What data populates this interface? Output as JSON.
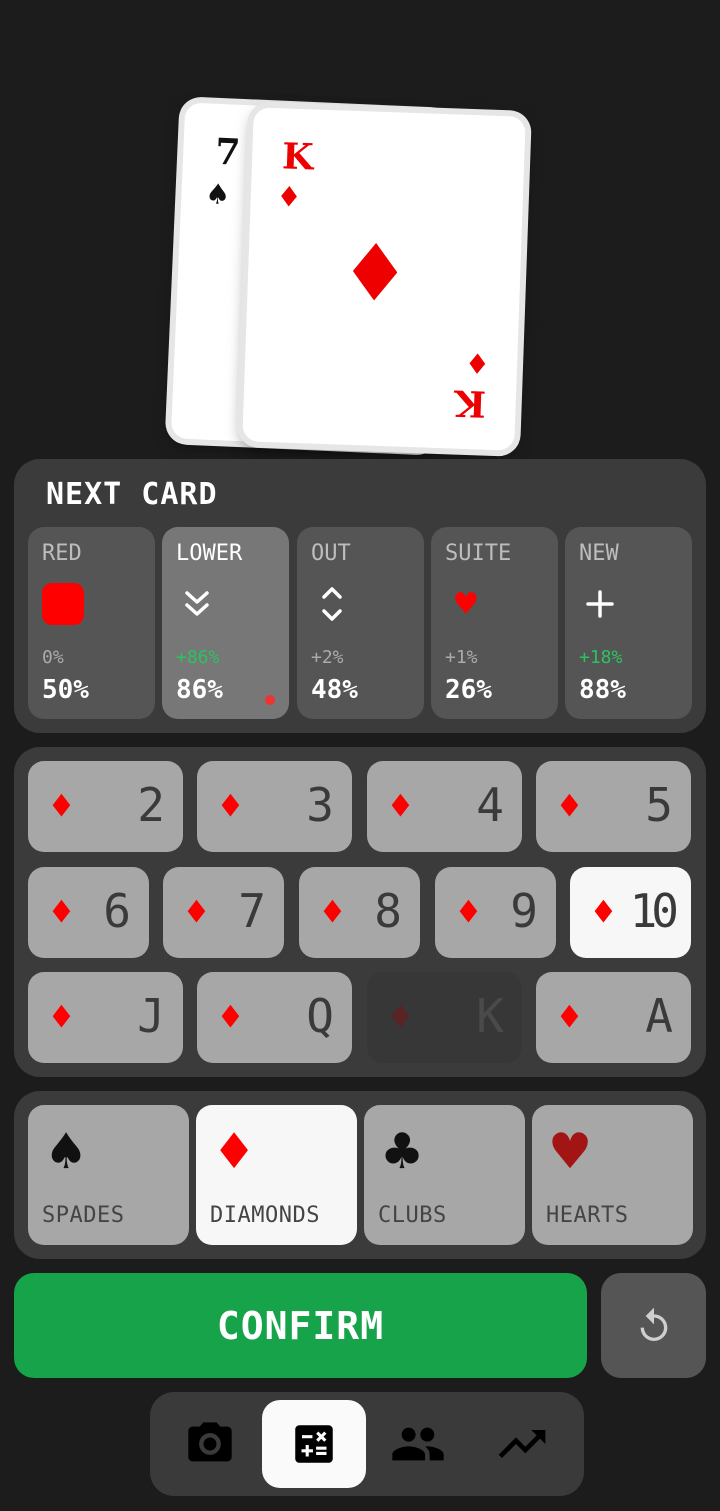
{
  "cards": {
    "back": {
      "rank": "7",
      "suit": "♠"
    },
    "front": {
      "rank": "K",
      "suit": "♦"
    }
  },
  "next_card": {
    "title": "NEXT CARD",
    "options": [
      {
        "label": "RED",
        "delta": "0%",
        "value": "50%"
      },
      {
        "label": "LOWER",
        "delta": "+86%",
        "value": "86%"
      },
      {
        "label": "OUT",
        "delta": "+2%",
        "value": "48%"
      },
      {
        "label": "SUITE",
        "delta": "+1%",
        "value": "26%"
      },
      {
        "label": "NEW",
        "delta": "+18%",
        "value": "88%"
      }
    ]
  },
  "ranks": {
    "suit_symbol": "♦",
    "row1": [
      "2",
      "3",
      "4",
      "5"
    ],
    "row2": [
      "6",
      "7",
      "8",
      "9",
      "10"
    ],
    "row3": [
      "J",
      "Q",
      "K",
      "A"
    ],
    "selected": "10",
    "disabled": "K"
  },
  "suits": [
    {
      "label": "SPADES",
      "symbol": "♠",
      "color": "#111111"
    },
    {
      "label": "DIAMONDS",
      "symbol": "♦",
      "color": "#ff0000"
    },
    {
      "label": "CLUBS",
      "symbol": "♣",
      "color": "#111111"
    },
    {
      "label": "HEARTS",
      "symbol": "♥",
      "color": "#a31515"
    }
  ],
  "selected_suit": "DIAMONDS",
  "confirm_label": "CONFIRM",
  "nav": {
    "items": [
      "camera-icon",
      "calculator-icon",
      "people-icon",
      "trending-icon"
    ],
    "active": "calculator-icon"
  },
  "colors": {
    "accent_green": "#16a34a",
    "positive": "#29c45e",
    "red": "#ff0000"
  }
}
